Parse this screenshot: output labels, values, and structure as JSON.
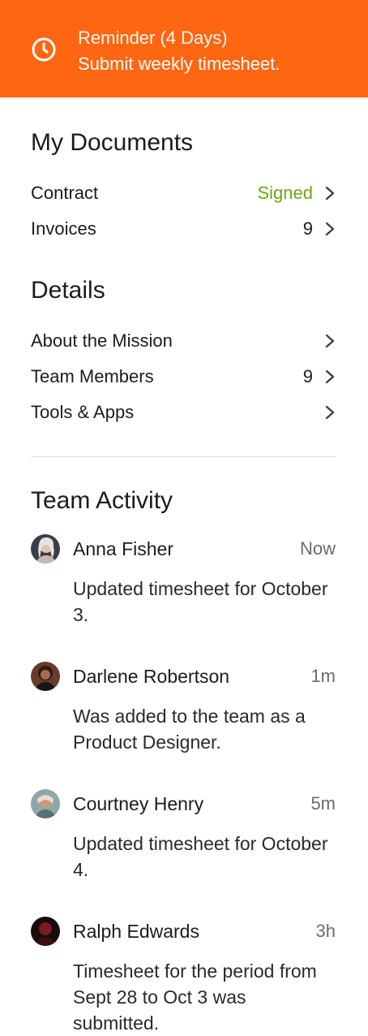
{
  "banner": {
    "icon": "clock-icon",
    "line1": "Reminder (4 Days)",
    "line2": "Submit weekly timesheet.",
    "background": "#ff6611"
  },
  "documents": {
    "title": "My Documents",
    "items": [
      {
        "label": "Contract",
        "value": "Signed"
      },
      {
        "label": "Invoices",
        "value": "9"
      }
    ]
  },
  "details": {
    "title": "Details",
    "items": [
      {
        "label": "About the Mission",
        "value": ""
      },
      {
        "label": "Team Members",
        "value": "9"
      },
      {
        "label": "Tools & Apps",
        "value": ""
      }
    ]
  },
  "activity": {
    "title": "Team Activity",
    "items": [
      {
        "name": "Anna Fisher",
        "time": "Now",
        "text": "Updated timesheet for October 3."
      },
      {
        "name": "Darlene Robertson",
        "time": "1m",
        "text": "Was added to the team as a Product Designer."
      },
      {
        "name": "Courtney Henry",
        "time": "5m",
        "text": "Updated timesheet for October 4."
      },
      {
        "name": "Ralph Edwards",
        "time": "3h",
        "text": "Timesheet for the period from Sept 28 to Oct 3 was submitted."
      }
    ]
  },
  "colors": {
    "accent": "#ff6611",
    "signed": "#6aa913"
  }
}
